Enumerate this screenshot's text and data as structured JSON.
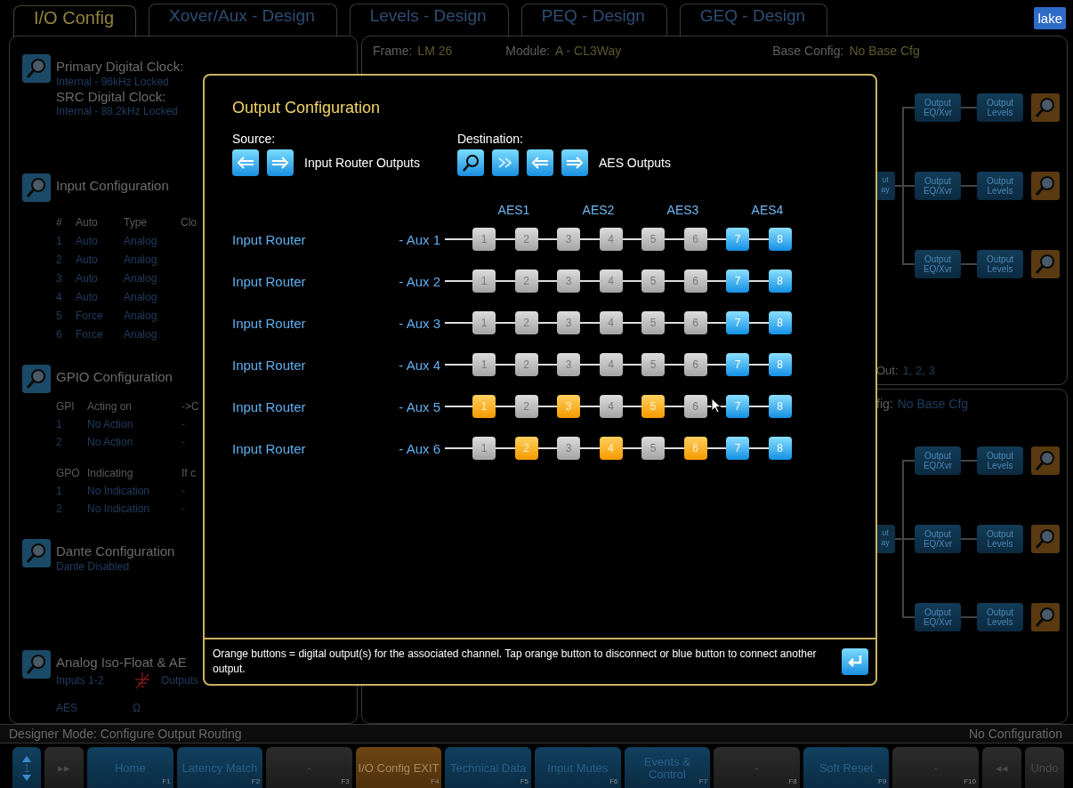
{
  "tabs": [
    {
      "label": "I/O Config",
      "selected": true
    },
    {
      "label": "Xover/Aux - Design",
      "selected": false
    },
    {
      "label": "Levels - Design",
      "selected": false
    },
    {
      "label": "PEQ - Design",
      "selected": false
    },
    {
      "label": "GEQ - Design",
      "selected": false
    }
  ],
  "logo": "lake",
  "left_panel": {
    "sections": [
      {
        "title": "Primary Digital Clock:",
        "blocks": [
          {
            "kind": "lines",
            "rows": [
              {
                "cells": [
                  {
                    "text": "Internal - 96kHz Locked",
                    "kind": "value"
                  }
                ]
              },
              {
                "cells": [
                  {
                    "text": "SRC Digital Clock:",
                    "kind": "title"
                  }
                ]
              },
              {
                "cells": [
                  {
                    "text": "Internal - 88.2kHz Locked",
                    "kind": "value"
                  }
                ]
              }
            ]
          }
        ]
      },
      {
        "title": "Input Configuration",
        "blocks": [
          {
            "kind": "table",
            "rows": [
              {
                "cells": [
                  {
                    "text": "#",
                    "kind": "head"
                  },
                  {
                    "text": "Auto",
                    "kind": "head"
                  },
                  {
                    "text": "Type",
                    "kind": "head"
                  },
                  {
                    "text": "Clo",
                    "kind": "head"
                  }
                ]
              },
              {
                "cells": [
                  {
                    "text": "1",
                    "kind": "value"
                  },
                  {
                    "text": "Auto",
                    "kind": "value"
                  },
                  {
                    "text": "Analog",
                    "kind": "value"
                  }
                ]
              },
              {
                "cells": [
                  {
                    "text": "2",
                    "kind": "value"
                  },
                  {
                    "text": "Auto",
                    "kind": "value"
                  },
                  {
                    "text": "Analog",
                    "kind": "value"
                  }
                ]
              },
              {
                "cells": [
                  {
                    "text": "3",
                    "kind": "value"
                  },
                  {
                    "text": "Auto",
                    "kind": "value"
                  },
                  {
                    "text": "Analog",
                    "kind": "value"
                  }
                ]
              },
              {
                "cells": [
                  {
                    "text": "4",
                    "kind": "value"
                  },
                  {
                    "text": "Auto",
                    "kind": "value"
                  },
                  {
                    "text": "Analog",
                    "kind": "value"
                  }
                ]
              },
              {
                "cells": [
                  {
                    "text": "5",
                    "kind": "value"
                  },
                  {
                    "text": "Force",
                    "kind": "value"
                  },
                  {
                    "text": "Analog",
                    "kind": "value"
                  }
                ]
              },
              {
                "cells": [
                  {
                    "text": "6",
                    "kind": "value"
                  },
                  {
                    "text": "Force",
                    "kind": "value"
                  },
                  {
                    "text": "Analog",
                    "kind": "value"
                  }
                ]
              }
            ]
          }
        ]
      },
      {
        "title": "GPIO Configuration",
        "blocks": [
          {
            "kind": "gpio",
            "rows": [
              {
                "cells": [
                  {
                    "text": "GPI",
                    "kind": "head"
                  },
                  {
                    "text": "Acting on",
                    "kind": "head"
                  },
                  {
                    "text": "->C",
                    "kind": "head"
                  }
                ]
              },
              {
                "cells": [
                  {
                    "text": "1",
                    "kind": "value"
                  },
                  {
                    "text": "No Action",
                    "kind": "value"
                  },
                  {
                    "text": "-",
                    "kind": "value"
                  }
                ]
              },
              {
                "cells": [
                  {
                    "text": "2",
                    "kind": "value"
                  },
                  {
                    "text": "No Action",
                    "kind": "value"
                  },
                  {
                    "text": "-",
                    "kind": "value"
                  }
                ]
              }
            ]
          },
          {
            "kind": "gpio",
            "rows": [
              {
                "cells": [
                  {
                    "text": "GPO",
                    "kind": "head"
                  },
                  {
                    "text": "Indicating",
                    "kind": "head"
                  },
                  {
                    "text": "If c",
                    "kind": "head"
                  }
                ]
              },
              {
                "cells": [
                  {
                    "text": "1",
                    "kind": "value"
                  },
                  {
                    "text": "No Indication",
                    "kind": "value"
                  },
                  {
                    "text": "-",
                    "kind": "value"
                  }
                ]
              },
              {
                "cells": [
                  {
                    "text": "2",
                    "kind": "value"
                  },
                  {
                    "text": "No Indication",
                    "kind": "value"
                  },
                  {
                    "text": "-",
                    "kind": "value"
                  }
                ]
              }
            ]
          }
        ]
      },
      {
        "title": "Dante Configuration",
        "blocks": [
          {
            "kind": "lines",
            "rows": [
              {
                "cells": [
                  {
                    "text": "Dante Disabled",
                    "kind": "value"
                  }
                ]
              }
            ]
          }
        ]
      },
      {
        "title": "Analog Iso-Float & AE",
        "blocks": [
          {
            "kind": "iso",
            "rows": [
              {
                "cells": [
                  {
                    "text": "Inputs 1-2",
                    "kind": "value"
                  },
                  {
                    "kind": "ground"
                  },
                  {
                    "text": "Outputs",
                    "kind": "value"
                  }
                ]
              },
              {
                "cells": [
                  {
                    "text": "AES",
                    "kind": "value"
                  },
                  {
                    "text": "Ω",
                    "kind": "value"
                  }
                ]
              }
            ]
          }
        ]
      }
    ]
  },
  "right_panel": {
    "header": [
      {
        "label": "Frame:",
        "value": "LM 26"
      },
      {
        "label": "Module:",
        "value": "A - CL3Way"
      },
      {
        "label": "Base Config:",
        "value": "No Base Cfg"
      }
    ],
    "modules": [
      {
        "stub": "ut ay",
        "chain": [
          {
            "eq": "Output EQ/Xvr",
            "levels": "Output Levels"
          },
          {
            "eq": "Output EQ/Xvr",
            "levels": "Output Levels"
          },
          {
            "eq": "Output EQ/Xvr",
            "levels": "Output Levels"
          }
        ],
        "footer": {
          "label": "Out:",
          "value": "1, 2, 3"
        }
      },
      {
        "header": {
          "label": "fig:",
          "value": "No Base Cfg"
        },
        "stub": "ut ay",
        "chain": [
          {
            "eq": "Output EQ/Xvr",
            "levels": "Output Levels"
          },
          {
            "eq": "Output EQ/Xvr",
            "levels": "Output Levels"
          },
          {
            "eq": "Output EQ/Xvr",
            "levels": "Output Levels"
          }
        ]
      }
    ]
  },
  "dialog": {
    "title": "Output Configuration",
    "source": {
      "label": "Source:",
      "value": "Input Router Outputs"
    },
    "destination": {
      "label": "Destination:",
      "value": "AES Outputs"
    },
    "groups": [
      "AES1",
      "AES2",
      "AES3",
      "AES4"
    ],
    "rows": [
      {
        "label": "Input Router",
        "channel": "- Aux 1",
        "outputs": [
          {
            "text": "1",
            "kind": "unavailable"
          },
          {
            "text": "2",
            "kind": "unavailable"
          },
          {
            "text": "3",
            "kind": "unavailable"
          },
          {
            "text": "4",
            "kind": "unavailable"
          },
          {
            "text": "5",
            "kind": "unavailable"
          },
          {
            "text": "6",
            "kind": "unavailable"
          },
          {
            "text": "7",
            "kind": "available"
          },
          {
            "text": "8",
            "kind": "available"
          }
        ]
      },
      {
        "label": "Input Router",
        "channel": "- Aux 2",
        "outputs": [
          {
            "text": "1",
            "kind": "unavailable"
          },
          {
            "text": "2",
            "kind": "unavailable"
          },
          {
            "text": "3",
            "kind": "unavailable"
          },
          {
            "text": "4",
            "kind": "unavailable"
          },
          {
            "text": "5",
            "kind": "unavailable"
          },
          {
            "text": "6",
            "kind": "unavailable"
          },
          {
            "text": "7",
            "kind": "available"
          },
          {
            "text": "8",
            "kind": "available"
          }
        ]
      },
      {
        "label": "Input Router",
        "channel": "- Aux 3",
        "outputs": [
          {
            "text": "1",
            "kind": "unavailable"
          },
          {
            "text": "2",
            "kind": "unavailable"
          },
          {
            "text": "3",
            "kind": "unavailable"
          },
          {
            "text": "4",
            "kind": "unavailable"
          },
          {
            "text": "5",
            "kind": "unavailable"
          },
          {
            "text": "6",
            "kind": "unavailable"
          },
          {
            "text": "7",
            "kind": "available"
          },
          {
            "text": "8",
            "kind": "available"
          }
        ]
      },
      {
        "label": "Input Router",
        "channel": "- Aux 4",
        "outputs": [
          {
            "text": "1",
            "kind": "unavailable"
          },
          {
            "text": "2",
            "kind": "unavailable"
          },
          {
            "text": "3",
            "kind": "unavailable"
          },
          {
            "text": "4",
            "kind": "unavailable"
          },
          {
            "text": "5",
            "kind": "unavailable"
          },
          {
            "text": "6",
            "kind": "unavailable"
          },
          {
            "text": "7",
            "kind": "available"
          },
          {
            "text": "8",
            "kind": "available"
          }
        ]
      },
      {
        "label": "Input Router",
        "channel": "- Aux 5",
        "outputs": [
          {
            "text": "1",
            "kind": "connected"
          },
          {
            "text": "2",
            "kind": "unavailable"
          },
          {
            "text": "3",
            "kind": "connected"
          },
          {
            "text": "4",
            "kind": "unavailable"
          },
          {
            "text": "5",
            "kind": "connected"
          },
          {
            "text": "6",
            "kind": "unavailable"
          },
          {
            "text": "7",
            "kind": "available"
          },
          {
            "text": "8",
            "kind": "available"
          }
        ]
      },
      {
        "label": "Input Router",
        "channel": "- Aux 6",
        "outputs": [
          {
            "text": "1",
            "kind": "unavailable"
          },
          {
            "text": "2",
            "kind": "connected"
          },
          {
            "text": "3",
            "kind": "unavailable"
          },
          {
            "text": "4",
            "kind": "connected"
          },
          {
            "text": "5",
            "kind": "unavailable"
          },
          {
            "text": "6",
            "kind": "connected"
          },
          {
            "text": "7",
            "kind": "available"
          },
          {
            "text": "8",
            "kind": "available"
          }
        ]
      }
    ],
    "help": "Orange buttons = digital output(s) for the associated channel. Tap orange button to disconnect or blue button to connect another output."
  },
  "status_bar": {
    "mode": "Designer Mode: Configure Output Routing",
    "config": "No Configuration"
  },
  "function_keys": [
    {
      "kind": "page",
      "label": "1",
      "selected": false,
      "disabled": false
    },
    {
      "kind": "short",
      "label": "▸▸",
      "selected": false,
      "disabled": true
    },
    {
      "kind": "key",
      "label": "Home",
      "hint": "F1",
      "selected": false,
      "disabled": false
    },
    {
      "kind": "key",
      "label": "Latency Match",
      "hint": "F2",
      "selected": false,
      "disabled": false
    },
    {
      "kind": "key",
      "label": "-",
      "hint": "F3",
      "selected": false,
      "disabled": true
    },
    {
      "kind": "key",
      "label": "I/O Config EXIT",
      "hint": "F4",
      "selected": true,
      "disabled": false
    },
    {
      "kind": "key",
      "label": "Technical Data",
      "hint": "F5",
      "selected": false,
      "disabled": false
    },
    {
      "kind": "key",
      "label": "Input Mutes",
      "hint": "F6",
      "selected": false,
      "disabled": false
    },
    {
      "kind": "key",
      "label": "Events & Control",
      "hint": "F7",
      "selected": false,
      "disabled": false
    },
    {
      "kind": "key",
      "label": "-",
      "hint": "F8",
      "selected": false,
      "disabled": true
    },
    {
      "kind": "key",
      "label": "Soft Reset",
      "hint": "F9",
      "selected": false,
      "disabled": false
    },
    {
      "kind": "key",
      "label": "-",
      "hint": "F10",
      "selected": false,
      "disabled": true
    },
    {
      "kind": "short",
      "label": "◂◂",
      "selected": false,
      "disabled": true
    },
    {
      "kind": "short",
      "label": "Undo",
      "selected": false,
      "disabled": true
    }
  ]
}
